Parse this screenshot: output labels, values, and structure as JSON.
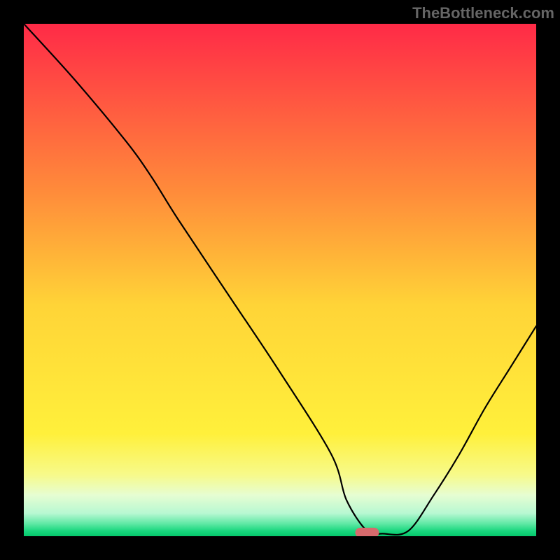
{
  "attribution": "TheBottleneck.com",
  "chart_data": {
    "type": "line",
    "title": "",
    "xlabel": "",
    "ylabel": "",
    "xlim": [
      0,
      100
    ],
    "ylim": [
      0,
      100
    ],
    "grid": false,
    "legend": false,
    "series": [
      {
        "name": "curve",
        "x": [
          0,
          10,
          20,
          25,
          30,
          40,
          50,
          60,
          63,
          67,
          70,
          75,
          80,
          85,
          90,
          95,
          100
        ],
        "y": [
          100,
          89,
          77,
          70,
          62,
          47,
          32,
          16,
          7,
          1,
          0.5,
          1,
          8,
          16,
          25,
          33,
          41
        ]
      }
    ],
    "marker": {
      "x": 67,
      "y": 0.7,
      "color": "#D76A6D"
    },
    "gradient_stops": [
      {
        "offset": 0.0,
        "color": "#FF2A47"
      },
      {
        "offset": 0.33,
        "color": "#FF8C3A"
      },
      {
        "offset": 0.55,
        "color": "#FFD437"
      },
      {
        "offset": 0.8,
        "color": "#FFF03B"
      },
      {
        "offset": 0.88,
        "color": "#F7FA8A"
      },
      {
        "offset": 0.92,
        "color": "#E6FDD2"
      },
      {
        "offset": 0.955,
        "color": "#B8F8D2"
      },
      {
        "offset": 0.975,
        "color": "#62E9A6"
      },
      {
        "offset": 0.99,
        "color": "#18D77E"
      },
      {
        "offset": 1.0,
        "color": "#05C76B"
      }
    ]
  }
}
